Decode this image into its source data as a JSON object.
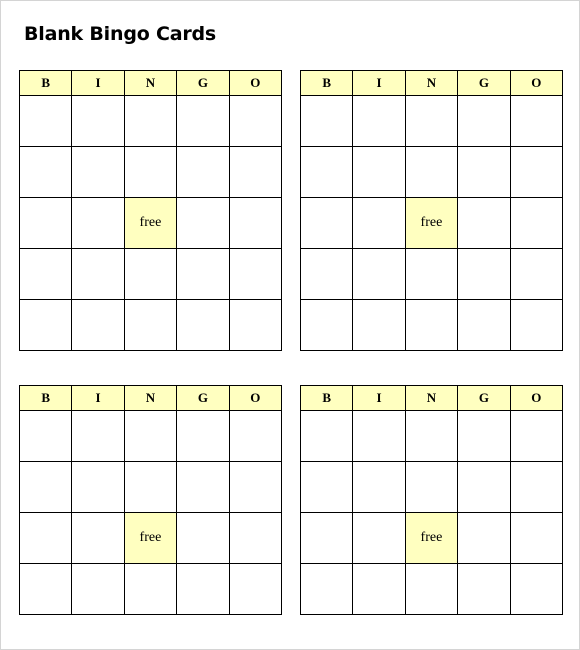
{
  "title": "Blank Bingo Cards",
  "colors": {
    "header_bg": "#ffffc0",
    "free_bg": "#ffffc0",
    "border": "#000000"
  },
  "cards": [
    {
      "headers": [
        "B",
        "I",
        "N",
        "G",
        "O"
      ],
      "rows": 5,
      "free_label": "free",
      "free_row": 3,
      "free_col": 3
    },
    {
      "headers": [
        "B",
        "I",
        "N",
        "G",
        "O"
      ],
      "rows": 5,
      "free_label": "free",
      "free_row": 3,
      "free_col": 3
    },
    {
      "headers": [
        "B",
        "I",
        "N",
        "G",
        "O"
      ],
      "rows": 4,
      "free_label": "free",
      "free_row": 3,
      "free_col": 3
    },
    {
      "headers": [
        "B",
        "I",
        "N",
        "G",
        "O"
      ],
      "rows": 4,
      "free_label": "free",
      "free_row": 3,
      "free_col": 3
    }
  ]
}
